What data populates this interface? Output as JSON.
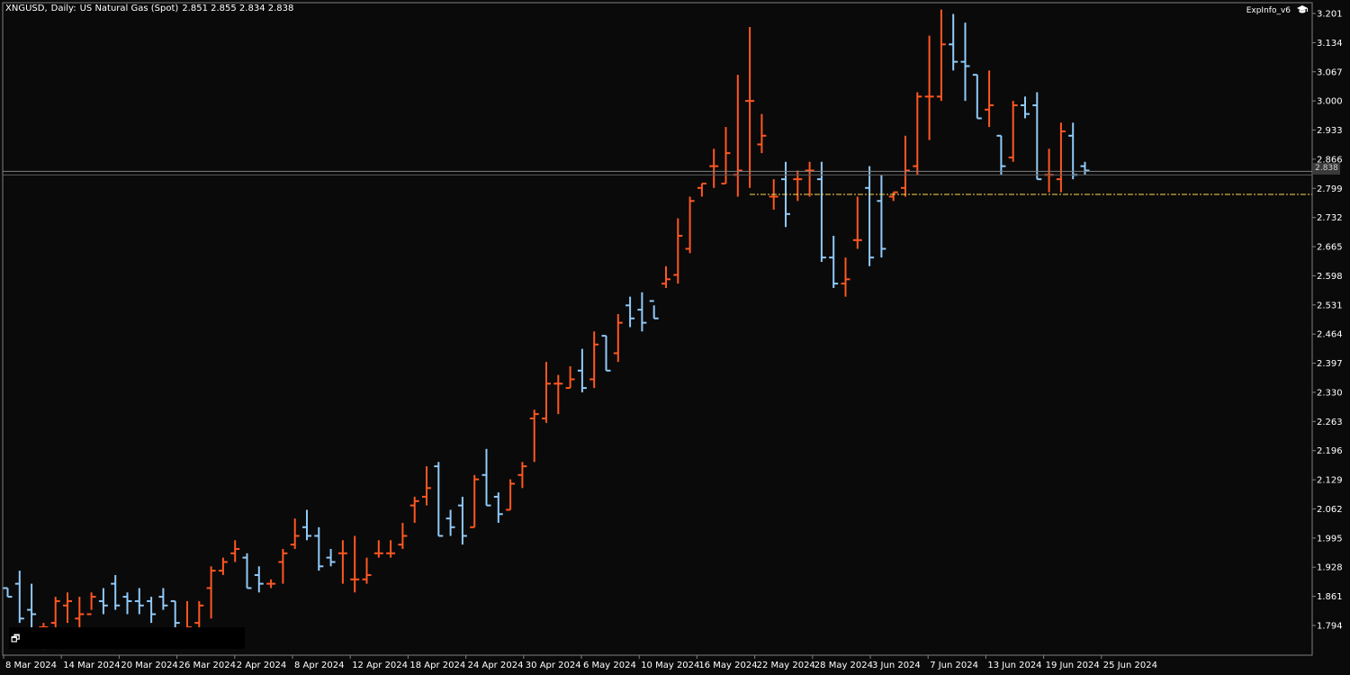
{
  "header": {
    "symbol": "XNGUSD,",
    "timeframe": "Daily:",
    "description": "US Natural Gas (Spot)",
    "ohlc": "2.851 2.855 2.834 2.838"
  },
  "indicator_label": "ExpInfo_v6",
  "icons": {
    "indicator": "graduation-cap-icon",
    "window": "window-restore-icon"
  },
  "current_price_label": "2.838",
  "colors": {
    "bull": "#ff5722",
    "bear": "#90caf9",
    "background": "#0a0a0a",
    "grid": "#808080",
    "level_line": "#ffd54f"
  },
  "chart_data": {
    "type": "ohlc-bar",
    "ylim": [
      1.76,
      3.215
    ],
    "y_ticks": [
      "3.201",
      "3.134",
      "3.067",
      "3.000",
      "2.933",
      "2.866",
      "2.799",
      "2.732",
      "2.665",
      "2.598",
      "2.531",
      "2.464",
      "2.397",
      "2.330",
      "2.263",
      "2.196",
      "2.129",
      "2.062",
      "1.995",
      "1.928",
      "1.861",
      "1.794"
    ],
    "x_ticks": [
      "8 Mar 2024",
      "14 Mar 2024",
      "20 Mar 2024",
      "26 Mar 2024",
      "2 Apr 2024",
      "8 Apr 2024",
      "12 Apr 2024",
      "18 Apr 2024",
      "24 Apr 2024",
      "30 Apr 2024",
      "6 May 2024",
      "10 May 2024",
      "16 May 2024",
      "22 May 2024",
      "28 May 2024",
      "3 Jun 2024",
      "7 Jun 2024",
      "13 Jun 2024",
      "19 Jun 2024",
      "25 Jun 2024"
    ],
    "current_price": 2.838,
    "level_line": 2.785,
    "bars": [
      [
        1.88,
        1.88,
        1.86,
        1.86
      ],
      [
        1.89,
        1.92,
        1.8,
        1.81
      ],
      [
        1.83,
        1.89,
        1.77,
        1.82
      ],
      [
        1.79,
        1.8,
        1.74,
        1.79
      ],
      [
        1.8,
        1.86,
        1.78,
        1.85
      ],
      [
        1.84,
        1.87,
        1.8,
        1.85
      ],
      [
        1.81,
        1.86,
        1.79,
        1.82
      ],
      [
        1.82,
        1.87,
        1.83,
        1.86
      ],
      [
        1.85,
        1.88,
        1.82,
        1.84
      ],
      [
        1.89,
        1.91,
        1.83,
        1.84
      ],
      [
        1.86,
        1.87,
        1.82,
        1.85
      ],
      [
        1.85,
        1.88,
        1.82,
        1.84
      ],
      [
        1.85,
        1.86,
        1.8,
        1.82
      ],
      [
        1.86,
        1.88,
        1.83,
        1.84
      ],
      [
        1.85,
        1.85,
        1.78,
        1.8
      ],
      [
        1.77,
        1.85,
        1.78,
        1.79
      ],
      [
        1.8,
        1.85,
        1.79,
        1.84
      ],
      [
        1.88,
        1.93,
        1.81,
        1.92
      ],
      [
        1.92,
        1.95,
        1.91,
        1.94
      ],
      [
        1.96,
        1.99,
        1.94,
        1.97
      ],
      [
        1.95,
        1.96,
        1.88,
        1.88
      ],
      [
        1.91,
        1.93,
        1.87,
        1.89
      ],
      [
        1.89,
        1.9,
        1.88,
        1.89
      ],
      [
        1.94,
        1.97,
        1.89,
        1.96
      ],
      [
        1.98,
        2.04,
        1.97,
        2.0
      ],
      [
        2.02,
        2.06,
        1.99,
        2.0
      ],
      [
        2.0,
        2.02,
        1.92,
        1.93
      ],
      [
        1.95,
        1.97,
        1.93,
        1.94
      ],
      [
        1.96,
        1.99,
        1.89,
        1.96
      ],
      [
        1.9,
        2.0,
        1.87,
        1.9
      ],
      [
        1.9,
        1.95,
        1.89,
        1.91
      ],
      [
        1.96,
        1.99,
        1.95,
        1.96
      ],
      [
        1.96,
        1.99,
        1.95,
        1.96
      ],
      [
        1.98,
        2.03,
        1.97,
        2.0
      ],
      [
        2.07,
        2.09,
        2.03,
        2.08
      ],
      [
        2.09,
        2.16,
        2.07,
        2.11
      ],
      [
        2.16,
        2.17,
        2.0,
        2.0
      ],
      [
        2.04,
        2.06,
        2.0,
        2.02
      ],
      [
        2.07,
        2.09,
        1.98,
        2.0
      ],
      [
        2.02,
        2.14,
        2.02,
        2.13
      ],
      [
        2.14,
        2.2,
        2.07,
        2.07
      ],
      [
        2.09,
        2.1,
        2.03,
        2.05
      ],
      [
        2.06,
        2.13,
        2.06,
        2.12
      ],
      [
        2.14,
        2.17,
        2.11,
        2.16
      ],
      [
        2.27,
        2.29,
        2.17,
        2.28
      ],
      [
        2.27,
        2.4,
        2.26,
        2.35
      ],
      [
        2.35,
        2.37,
        2.28,
        2.35
      ],
      [
        2.34,
        2.39,
        2.34,
        2.36
      ],
      [
        2.38,
        2.43,
        2.33,
        2.34
      ],
      [
        2.36,
        2.47,
        2.34,
        2.44
      ],
      [
        2.46,
        2.46,
        2.38,
        2.38
      ],
      [
        2.42,
        2.51,
        2.4,
        2.49
      ],
      [
        2.53,
        2.55,
        2.48,
        2.5
      ],
      [
        2.52,
        2.56,
        2.47,
        2.49
      ],
      [
        2.54,
        2.53,
        2.5,
        2.5
      ],
      [
        2.58,
        2.62,
        2.57,
        2.59
      ],
      [
        2.6,
        2.73,
        2.58,
        2.69
      ],
      [
        2.66,
        2.78,
        2.65,
        2.77
      ],
      [
        2.8,
        2.81,
        2.78,
        2.81
      ],
      [
        2.85,
        2.89,
        2.8,
        2.85
      ],
      [
        2.81,
        2.94,
        2.81,
        2.88
      ],
      [
        2.83,
        3.06,
        2.78,
        2.84
      ],
      [
        3.0,
        3.17,
        2.8,
        3.0
      ],
      [
        2.9,
        2.97,
        2.88,
        2.92
      ],
      [
        2.78,
        2.82,
        2.75,
        2.78
      ],
      [
        2.82,
        2.86,
        2.71,
        2.74
      ],
      [
        2.82,
        2.84,
        2.77,
        2.82
      ],
      [
        2.84,
        2.86,
        2.78,
        2.84
      ],
      [
        2.82,
        2.86,
        2.63,
        2.64
      ],
      [
        2.64,
        2.69,
        2.57,
        2.58
      ],
      [
        2.58,
        2.64,
        2.55,
        2.59
      ],
      [
        2.68,
        2.78,
        2.66,
        2.68
      ],
      [
        2.8,
        2.85,
        2.62,
        2.64
      ],
      [
        2.77,
        2.83,
        2.64,
        2.66
      ],
      [
        2.78,
        2.79,
        2.77,
        2.79
      ],
      [
        2.8,
        2.92,
        2.78,
        2.84
      ],
      [
        2.85,
        3.02,
        2.83,
        3.01
      ],
      [
        3.01,
        3.15,
        2.91,
        3.01
      ],
      [
        3.01,
        3.21,
        3.0,
        3.13
      ],
      [
        3.13,
        3.2,
        3.07,
        3.09
      ],
      [
        3.09,
        3.18,
        3.0,
        3.08
      ],
      [
        3.06,
        3.06,
        2.96,
        2.96
      ],
      [
        2.98,
        3.07,
        2.94,
        2.99
      ],
      [
        2.92,
        2.92,
        2.83,
        2.85
      ],
      [
        2.87,
        3.0,
        2.86,
        2.99
      ],
      [
        2.99,
        3.01,
        2.96,
        2.97
      ],
      [
        2.99,
        3.02,
        2.82,
        2.82
      ],
      [
        2.83,
        2.89,
        2.79,
        2.83
      ],
      [
        2.82,
        2.95,
        2.79,
        2.93
      ],
      [
        2.92,
        2.95,
        2.82,
        2.83
      ],
      [
        2.85,
        2.86,
        2.83,
        2.84
      ]
    ]
  }
}
